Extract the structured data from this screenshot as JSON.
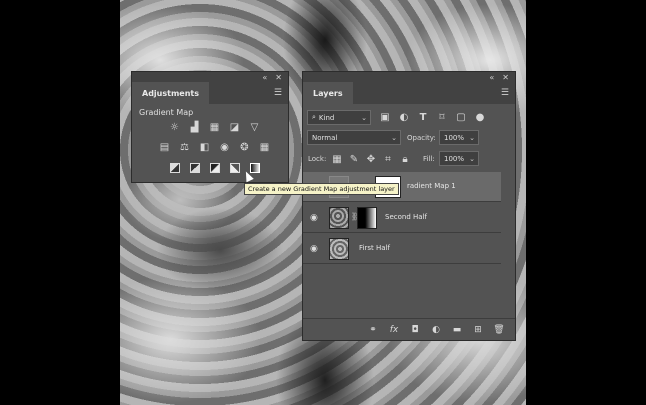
{
  "adjustments_panel": {
    "tab_label": "Adjustments",
    "section_title": "Gradient Map",
    "icons_row1": [
      "brightness-icon",
      "levels-icon",
      "curves-icon",
      "exposure-icon",
      "vibrance-icon"
    ],
    "icons_row2": [
      "hue-saturation-icon",
      "color-balance-icon",
      "black-white-icon",
      "photo-filter-icon",
      "channel-mixer-icon",
      "color-lookup-icon"
    ],
    "icons_row3": [
      "invert-icon",
      "posterize-icon",
      "threshold-icon",
      "selective-color-icon",
      "gradient-map-icon"
    ]
  },
  "tooltip": {
    "text": "Create a new Gradient Map adjustment layer"
  },
  "layers_panel": {
    "tab_label": "Layers",
    "filter_kind": "Kind",
    "blend_mode": "Normal",
    "opacity_label": "Opacity:",
    "opacity_value": "100%",
    "lock_label": "Lock:",
    "fill_label": "Fill:",
    "fill_value": "100%",
    "layers": [
      {
        "name": "Gradient Map 1",
        "visible_label": "radient Map 1"
      },
      {
        "name": "Second Half"
      },
      {
        "name": "First Half"
      }
    ]
  },
  "colors": {
    "panel_bg": "#535353",
    "panel_dark": "#424242",
    "selected_row": "#6a6a6a",
    "tooltip_bg": "#f6f3c8"
  }
}
